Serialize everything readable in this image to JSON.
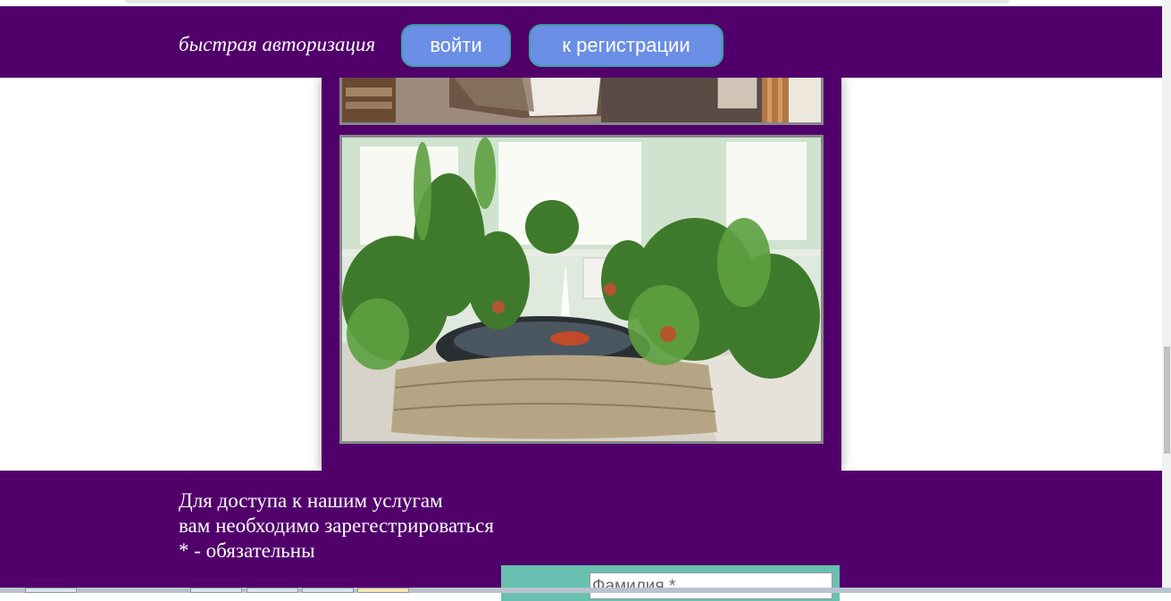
{
  "header": {
    "quick_auth_label": "быстрая авторизация",
    "login_button": "войти",
    "register_button": "к регистрации"
  },
  "gallery": {
    "images": [
      {
        "name": "bedroom-photo",
        "description_icon": "hotel-room-image"
      },
      {
        "name": "plants-fountain-photo",
        "description_icon": "winter-garden-image"
      }
    ]
  },
  "registration": {
    "line1": "Для доступа к нашим услугам",
    "line2": "вам необходимо зарегестрироваться",
    "line3": "* - обязательны",
    "surname_placeholder": "Фамилия *"
  },
  "colors": {
    "brand_purple": "#51006b",
    "button_blue": "#6b8ee6",
    "form_teal": "#6ac0b0"
  }
}
